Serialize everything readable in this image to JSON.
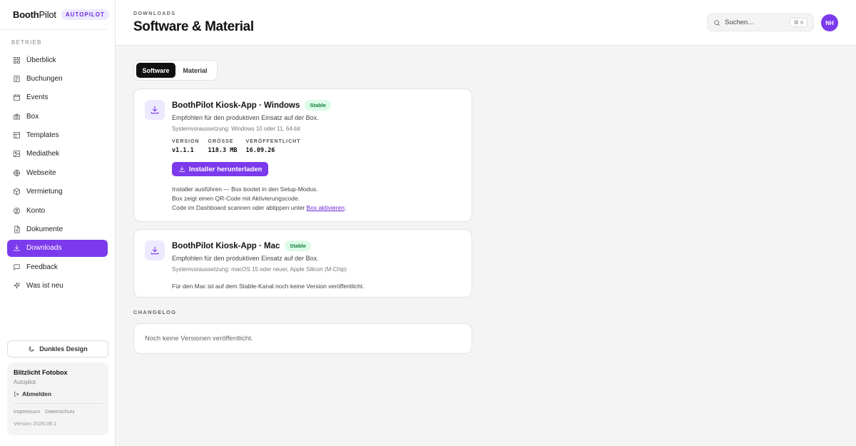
{
  "brand": {
    "name_bold": "Booth",
    "name_light": "Pilot",
    "tag": "AUTOPILOT"
  },
  "sidebar": {
    "section": "BETRIEB",
    "items": [
      {
        "label": "Überblick",
        "icon": "grid-icon",
        "active": false
      },
      {
        "label": "Buchungen",
        "icon": "list-icon",
        "active": false
      },
      {
        "label": "Events",
        "icon": "calendar-icon",
        "active": false
      },
      {
        "label": "Box",
        "icon": "camera-icon",
        "active": false
      },
      {
        "label": "Templates",
        "icon": "layers-icon",
        "active": false
      },
      {
        "label": "Mediathek",
        "icon": "image-icon",
        "active": false
      },
      {
        "label": "Webseite",
        "icon": "globe-icon",
        "active": false
      },
      {
        "label": "Vermietung",
        "icon": "package-icon",
        "active": false
      },
      {
        "label": "Konto",
        "icon": "user-circle-icon",
        "active": false
      },
      {
        "label": "Dokumente",
        "icon": "document-icon",
        "active": false
      },
      {
        "label": "Downloads",
        "icon": "download-icon",
        "active": true
      },
      {
        "label": "Feedback",
        "icon": "chat-icon",
        "active": false
      },
      {
        "label": "Was ist neu",
        "icon": "sparkle-icon",
        "active": false
      }
    ],
    "dark_mode_label": "Dunkles Design",
    "account": {
      "name": "Blitzlicht Fotobox",
      "plan": "Autopilot",
      "logout": "Abmelden",
      "imprint": "Impressum",
      "privacy": "Datenschutz",
      "version": "Version 2026.08.1"
    }
  },
  "header": {
    "eyebrow": "DOWNLOADS",
    "title": "Software & Material",
    "search_placeholder": "Suchen...",
    "search_shortcut": "⌘ K",
    "avatar_initials": "NH"
  },
  "tabs": [
    {
      "label": "Software",
      "active": true
    },
    {
      "label": "Material",
      "active": false
    }
  ],
  "windows": {
    "title": "BoothPilot Kiosk-App · Windows",
    "badge": "Stable",
    "desc": "Empfohlen für den produktiven Einsatz auf der Box.",
    "req": "Systemvoraussetzung: Windows 10 oder 11, 64-bit",
    "version_label": "VERSION",
    "version": "v1.1.1",
    "size_label": "GRÖSSE",
    "size": "118.3 MB",
    "published_label": "VERÖFFENTLICHT",
    "published": "16.09.26",
    "download_label": "Installer herunterladen",
    "step1": "Installer ausführen — Box bootet in den Setup-Modus.",
    "step2": "Box zeigt einen QR-Code mit Aktivierungscode.",
    "step3_prefix": "Code im Dashboard scannen oder abtippen unter ",
    "step3_link": "Box aktivieren",
    "step3_suffix": "."
  },
  "mac": {
    "title": "BoothPilot Kiosk-App · Mac",
    "badge": "Stable",
    "desc": "Empfohlen für den produktiven Einsatz auf der Box.",
    "req": "Systemvoraussetzung: macOS 15 oder neuer, Apple Silicon (M-Chip)",
    "note": "Für den Mac ist auf dem Stable-Kanal noch keine Version veröffentlicht."
  },
  "changelog": {
    "label": "CHANGELOG",
    "empty": "Noch keine Versionen veröffentlicht."
  },
  "colors": {
    "accent": "#7c3aed",
    "badge_bg": "#dcfce7",
    "badge_text": "#15803d"
  }
}
